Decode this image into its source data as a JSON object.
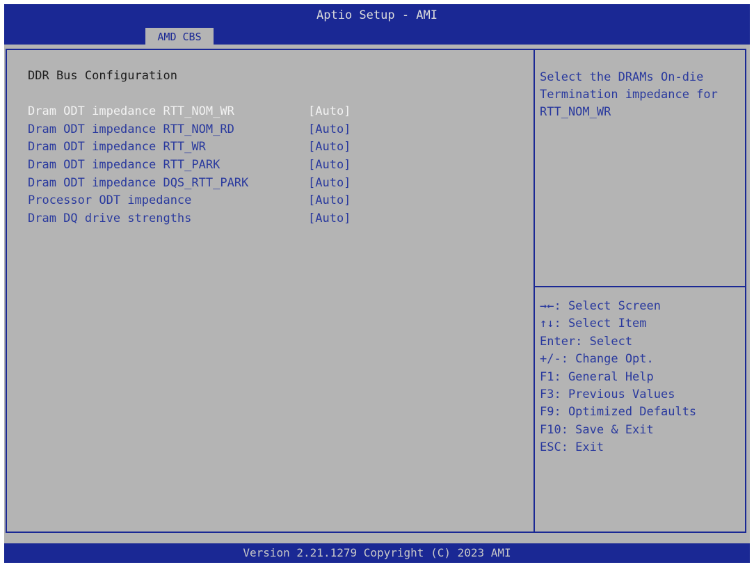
{
  "header": {
    "title": "Aptio Setup - AMI",
    "tab_label": "AMD CBS"
  },
  "main": {
    "section_title": "DDR Bus Configuration",
    "selected_index": 0,
    "settings": [
      {
        "label": "Dram ODT impedance RTT_NOM_WR",
        "value": "[Auto]"
      },
      {
        "label": "Dram ODT impedance RTT_NOM_RD",
        "value": "[Auto]"
      },
      {
        "label": "Dram ODT impedance RTT_WR",
        "value": "[Auto]"
      },
      {
        "label": "Dram ODT impedance RTT_PARK",
        "value": "[Auto]"
      },
      {
        "label": "Dram ODT impedance DQS_RTT_PARK",
        "value": "[Auto]"
      },
      {
        "label": "Processor ODT impedance",
        "value": "[Auto]"
      },
      {
        "label": "Dram DQ drive strengths",
        "value": "[Auto]"
      }
    ]
  },
  "help": {
    "text": "Select the DRAMs On-die\nTermination impedance for\nRTT_NOM_WR"
  },
  "keys": [
    "→←: Select Screen",
    "↑↓: Select Item",
    "Enter: Select",
    "+/-: Change Opt.",
    "F1: General Help",
    "F3: Previous Values",
    "F9: Optimized Defaults",
    "F10: Save & Exit",
    "ESC: Exit"
  ],
  "footer": {
    "version": "Version 2.21.1279 Copyright (C) 2023 AMI"
  },
  "colors": {
    "header_bg": "#1a2894",
    "panel_bg": "#b4b4b4",
    "item_text": "#2a3a9e",
    "selected_text": "#f2f2f2"
  }
}
